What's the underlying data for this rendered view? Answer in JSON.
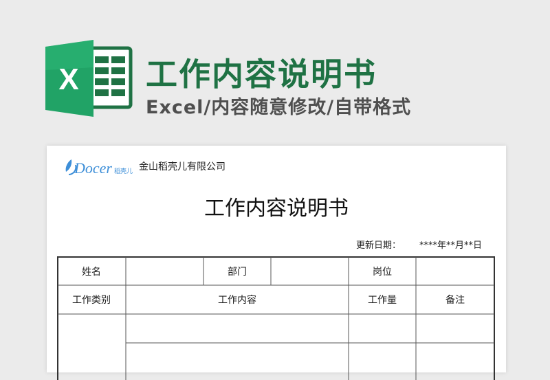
{
  "banner": {
    "logo_letter": "X",
    "title": "工作内容说明书",
    "subtitle": "Excel/内容随意修改/自带格式"
  },
  "document": {
    "brand_logo": "Docer稻壳儿",
    "company": "金山稻壳儿有限公司",
    "title": "工作内容说明书",
    "update_label": "更新日期：",
    "update_value": "****年**月**日",
    "table": {
      "row1": [
        "姓名",
        "",
        "部门",
        "",
        "岗位",
        ""
      ],
      "row2": [
        "工作类别",
        "工作内容",
        "工作量",
        "备注"
      ]
    }
  },
  "colors": {
    "accent_green": "#1f7244",
    "excel_green": "#21a366",
    "docer_blue": "#3e8fd8",
    "background": "#ebebeb"
  },
  "icons": [
    "excel-logo-icon",
    "docer-logo-icon"
  ]
}
